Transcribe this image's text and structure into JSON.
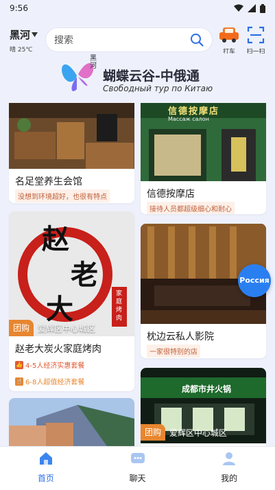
{
  "status_bar": {
    "time": "9:56"
  },
  "header": {
    "city": "黑河",
    "weather": "晴 25℃",
    "search_placeholder": "搜索",
    "taxi_label": "打车",
    "scan_label": "扫一扫"
  },
  "banner": {
    "logo_text": "黑河",
    "title": "蝴蝶云谷-中俄通",
    "subtitle": "Свободный тур по Китаю"
  },
  "cards": {
    "c1": {
      "title": "名足堂养生会馆",
      "tag": "没想到环境超好，也很有特点"
    },
    "c2": {
      "title": "信德按摩店",
      "tag": "接待人员都超级细心和耐心",
      "sign": "信德按摩店",
      "sign_sub": "Массаж салон"
    },
    "c3": {
      "title": "赵老大炭火家庭烤肉",
      "badge": "团购",
      "area": "爱辉区中心城区",
      "logo_chars": [
        "赵",
        "老",
        "大"
      ],
      "side_text": "家庭烤肉",
      "deals": [
        "4-5人经济实惠套餐",
        "6-8人超值经济套餐"
      ]
    },
    "c4": {
      "title": "枕边云私人影院",
      "tag": "一家很特别的店"
    },
    "c5": {
      "badge": "团购",
      "area": "爱辉区中心城区",
      "sign": "成都市井火锅"
    }
  },
  "russia_button": "Россия",
  "tabbar": [
    {
      "label": "首页",
      "active": true
    },
    {
      "label": "聊天",
      "active": false
    },
    {
      "label": "我的",
      "active": false
    }
  ],
  "colors": {
    "accent": "#2a6fe8",
    "deal": "#e05a32",
    "badge": "#e8862f"
  }
}
